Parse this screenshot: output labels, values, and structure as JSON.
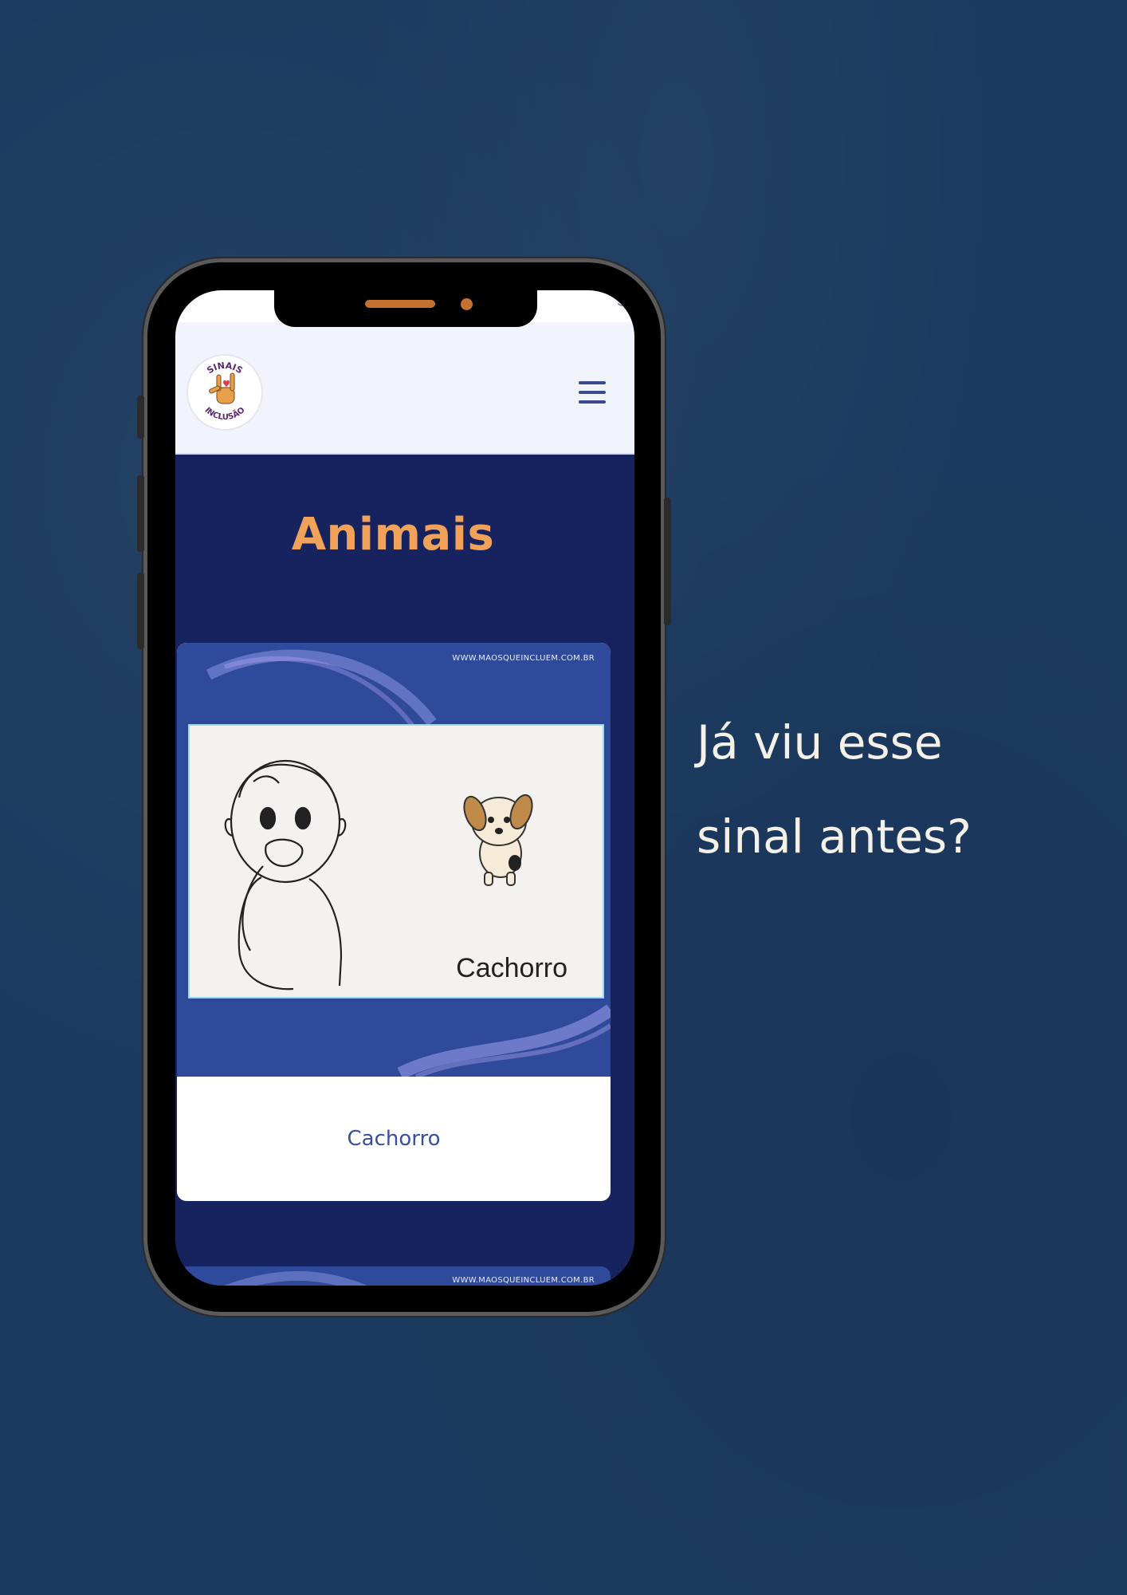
{
  "colors": {
    "background": "#1c3a5f",
    "accent_orange": "#f0a25a",
    "screen_navy": "#17235f",
    "card_blue": "#2f4a9a",
    "link_blue": "#3a4fa0"
  },
  "header": {
    "logo_text_top": "SINAIS",
    "logo_text_bottom": "INCLUSÃO",
    "menu_icon": "hamburger-menu-icon"
  },
  "page": {
    "title": "Animais"
  },
  "cards": [
    {
      "watermark": "WWW.MAOSQUEINCLUEM.COM.BR",
      "sign_word": "Cachorro",
      "caption": "Cachorro"
    },
    {
      "watermark": "WWW.MAOSQUEINCLUEM.COM.BR"
    }
  ],
  "side_text": {
    "line1": "Já viu esse",
    "line2": "sinal antes?"
  }
}
